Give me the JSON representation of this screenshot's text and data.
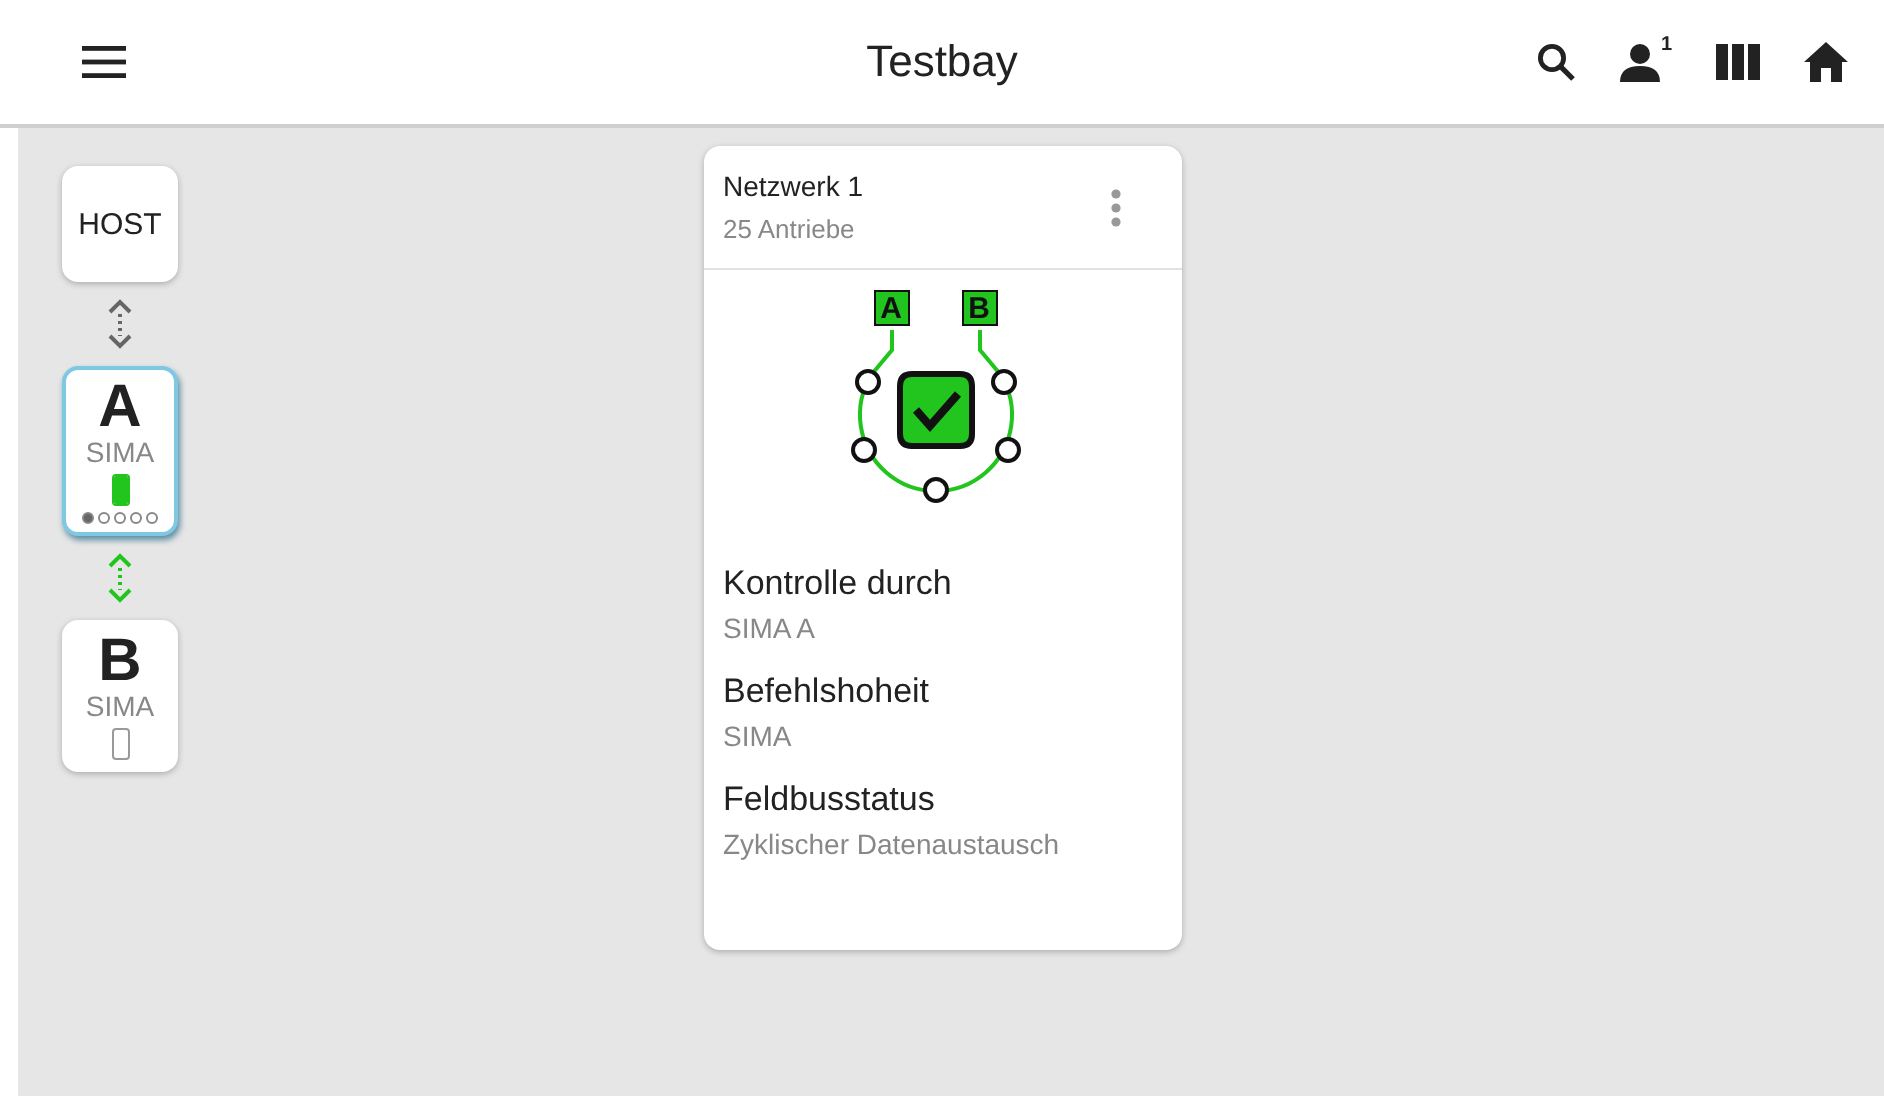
{
  "header": {
    "title": "Testbay",
    "user_badge": "1"
  },
  "devices": [
    {
      "kind": "host",
      "label": "HOST",
      "selected": false
    },
    {
      "kind": "sima",
      "letter": "A",
      "label": "SIMA",
      "selected": true,
      "level": 1,
      "pages": [
        {
          "selected": true
        },
        {
          "selected": false
        },
        {
          "selected": false
        },
        {
          "selected": false
        },
        {
          "selected": false
        }
      ]
    },
    {
      "kind": "sima",
      "letter": "B",
      "label": "SIMA",
      "selected": false,
      "level": 0
    }
  ],
  "links": [
    {
      "active": false
    },
    {
      "active": true
    }
  ],
  "network": {
    "title": "Netzwerk 1",
    "subtitle": "25 Antriebe",
    "diagram": {
      "left_label": "A",
      "right_label": "B",
      "ok": true
    },
    "fields": [
      {
        "label": "Kontrolle durch",
        "value": "SIMA A"
      },
      {
        "label": "Befehlshoheit",
        "value": "SIMA"
      },
      {
        "label": "Feldbusstatus",
        "value": "Zyklischer Datenaustausch"
      }
    ]
  }
}
